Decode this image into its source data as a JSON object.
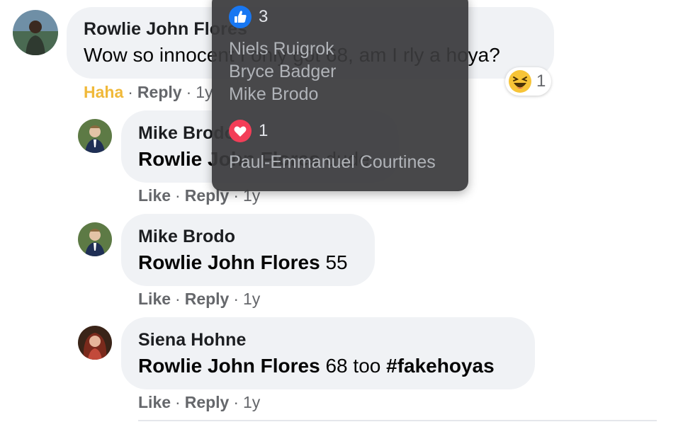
{
  "comments": [
    {
      "author": "Rowlie John Flores",
      "text": "Wow so innocent I only got 68, am I rly a hoya?",
      "reaction_label": "Haha",
      "reply_label": "Reply",
      "time": "1y",
      "reaction_count": "1",
      "reaction_icon": "haha-emoji-icon"
    },
    {
      "author": "Mike Brodo",
      "mention": "Rowlie John Flores",
      "text": "dude",
      "like_label": "Like",
      "reply_label": "Reply",
      "time": "1y"
    },
    {
      "author": "Mike Brodo",
      "mention": "Rowlie John Flores",
      "text": "55",
      "like_label": "Like",
      "reply_label": "Reply",
      "time": "1y"
    },
    {
      "author": "Siena Hohne",
      "mention": "Rowlie John Flores",
      "text": "68 too",
      "hashtag": "#fakehoyas",
      "like_label": "Like",
      "reply_label": "Reply",
      "time": "1y"
    }
  ],
  "separator": "·",
  "tooltip": {
    "like": {
      "icon": "like-thumb-icon",
      "count": "3",
      "names": [
        "Niels Ruigrok",
        "Bryce Badger",
        "Mike Brodo"
      ]
    },
    "love": {
      "icon": "love-heart-icon",
      "count": "1",
      "names": [
        "Paul-Emmanuel Courtines"
      ]
    }
  },
  "colors": {
    "bubble": "#f0f2f5",
    "haha": "#f0b93a",
    "meta": "#65676b",
    "like_blue": "#1877f2",
    "love_red": "#f33e58",
    "tooltip_bg": "#3a3a3c"
  }
}
